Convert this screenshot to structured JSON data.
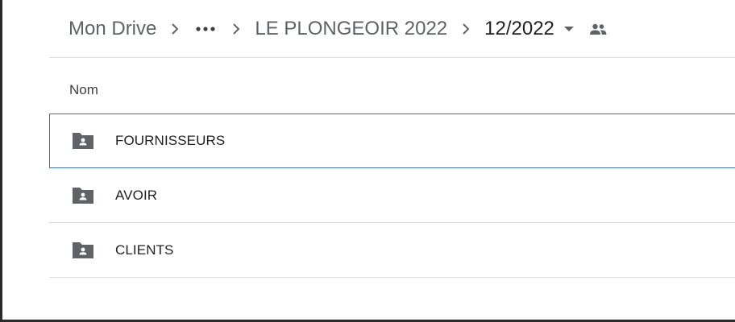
{
  "breadcrumb": {
    "root": "Mon Drive",
    "folder": "LE PLONGEOIR 2022",
    "current": "12/2022",
    "icons": {
      "separator": "chevron-right-icon",
      "more": "more-horiz-icon",
      "dropdown": "arrow-drop-down-icon",
      "shared": "people-icon"
    }
  },
  "table": {
    "column_name": "Nom",
    "rows": [
      {
        "name": "FOURNISSEURS",
        "icon": "shared-folder-icon",
        "selected": true
      },
      {
        "name": "AVOIR",
        "icon": "shared-folder-icon",
        "selected": false
      },
      {
        "name": "CLIENTS",
        "icon": "shared-folder-icon",
        "selected": false
      }
    ]
  },
  "colors": {
    "selection_border": "#3b6fb6",
    "folder_icon": "#5f6368",
    "divider": "#dadce0"
  }
}
